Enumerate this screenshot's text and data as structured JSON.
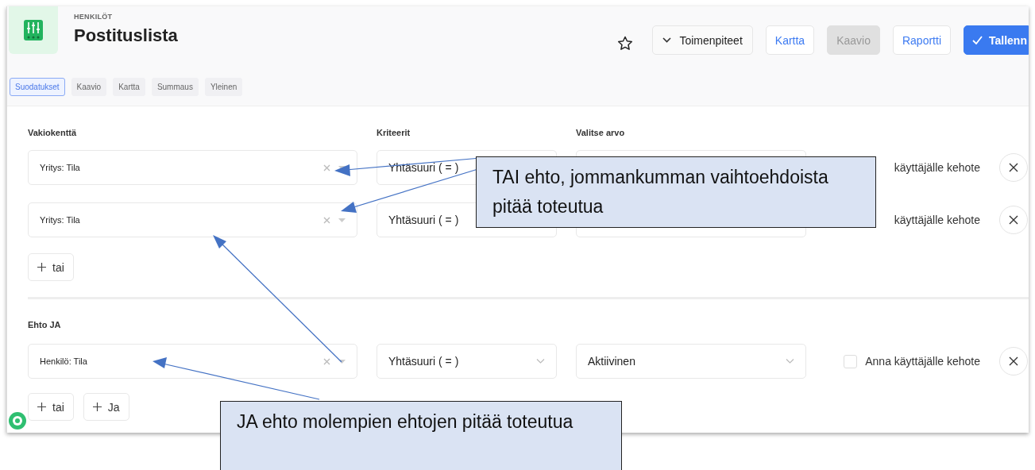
{
  "header": {
    "category": "HENKILÖT",
    "title": "Postituslista",
    "actions": [
      {
        "kind": "menu",
        "label": "Toimenpiteet",
        "disabled": false
      },
      {
        "kind": "link",
        "label": "Kartta",
        "disabled": false
      },
      {
        "kind": "link",
        "label": "Kaavio",
        "disabled": true
      },
      {
        "kind": "link",
        "label": "Raportti",
        "disabled": false
      },
      {
        "kind": "primary",
        "label": "Tallenn",
        "disabled": false
      }
    ]
  },
  "tabs": [
    {
      "label": "Suodatukset",
      "selected": true
    },
    {
      "label": "Kaavio",
      "selected": false
    },
    {
      "label": "Kartta",
      "selected": false
    },
    {
      "label": "Summaus",
      "selected": false
    },
    {
      "label": "Yleinen",
      "selected": false
    }
  ],
  "groups": [
    {
      "headers": [
        "Vakiokenttä",
        "Kriteerit",
        "Valitse arvo"
      ],
      "conditions": [
        {
          "field": "Yritys: Tila",
          "criterion": "Yhtäsuuri ( = )",
          "prompt_label": "käyttäjälle kehote"
        },
        {
          "field": "Yritys: Tila",
          "criterion": "Yhtäsuuri ( = )",
          "prompt_label": "käyttäjälle kehote"
        }
      ],
      "add_buttons": [
        "tai"
      ]
    },
    {
      "title": "Ehto JA",
      "conditions": [
        {
          "field": "Henkilö: Tila",
          "criterion": "Yhtäsuuri ( = )",
          "value": "Aktiivinen",
          "checked": false,
          "prompt_label": "Anna käyttäjälle kehote"
        }
      ],
      "add_buttons": [
        "tai",
        "Ja"
      ]
    }
  ],
  "callouts": [
    {
      "text": "TAI ehto, jommankumman vaihtoehdoista pitää toteutua"
    },
    {
      "text": "JA ehto molempien ehtojen pitää toteutua"
    }
  ]
}
